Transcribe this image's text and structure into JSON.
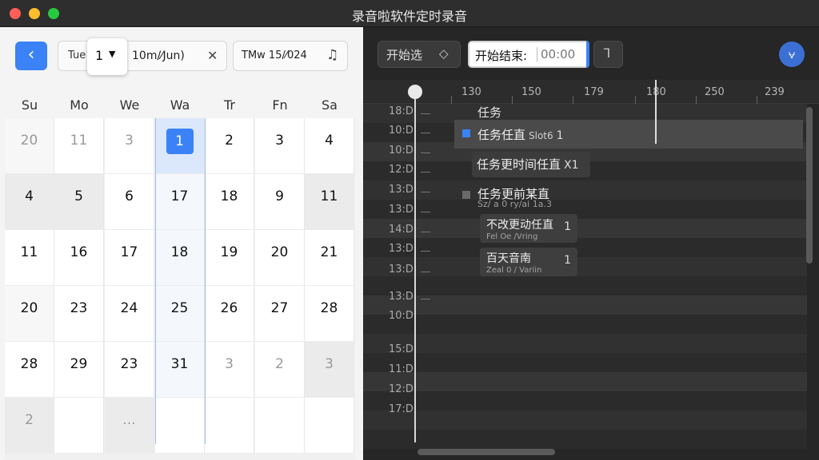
{
  "window": {
    "title": "录音啦软件定时录音"
  },
  "calendar_toolbar": {
    "back_icon": "chevron-left-icon",
    "filter_label": "Tue",
    "filter_dropdown_value": "1",
    "filter_date": "10m/⁄Jun)",
    "clear_icon": "close-icon",
    "timezone_text": "TMw 15/⁄024",
    "timezone_icon": "music-note-icon"
  },
  "calendar": {
    "weekdays": [
      "Su",
      "Mo",
      "We",
      "Wa",
      "Tr",
      "Fn",
      "Sa"
    ],
    "weeks": [
      [
        "20",
        "11",
        "3",
        "1",
        "2",
        "3",
        "4"
      ],
      [
        "4",
        "5",
        "6",
        "17",
        "18",
        "9",
        "11"
      ],
      [
        "11",
        "16",
        "17",
        "18",
        "19",
        "20",
        "21"
      ],
      [
        "20",
        "23",
        "24",
        "25",
        "26",
        "27",
        "28"
      ],
      [
        "28",
        "29",
        "23",
        "31",
        "3",
        "2",
        "3"
      ],
      [
        "2",
        "",
        "...",
        "",
        "",
        "",
        ""
      ]
    ],
    "today_label": "1"
  },
  "timeline_toolbar": {
    "start_select_label": "开始选",
    "start_select_icon": "diamond-icon",
    "end_label": "开始结束:",
    "end_time": "00:00",
    "snap_icon": "hook-icon",
    "avatar_icon": "collapse-icon",
    "avatar_glyph": "⩝"
  },
  "ruler": {
    "ticks": [
      "130",
      "150",
      "179",
      "180",
      "250",
      "239"
    ]
  },
  "rows": {
    "labels": [
      "18:D",
      "10:D",
      "10:D",
      "12:D",
      "13:D",
      "13:D",
      "14:D",
      "13:D",
      "13:D",
      "13:D",
      "10:D",
      "15:D",
      "11:D",
      "12:D",
      "17:D"
    ]
  },
  "tasks": {
    "header": "任务",
    "task1": {
      "label": "任务任直",
      "sub": "Slot6",
      "count": "1"
    },
    "task2": {
      "label": "任务更时间任直",
      "count": "X1"
    },
    "task3": {
      "label": "任务更前某直",
      "sub": "Sz/ a 0 ry/ai 1a.3"
    },
    "task4": {
      "label": "不改更动任直",
      "sub": "Fel Oe /Vring",
      "count": "1"
    },
    "task5": {
      "label": "百天音南",
      "sub": "Zeal 0 / Variin",
      "count": "1"
    }
  }
}
